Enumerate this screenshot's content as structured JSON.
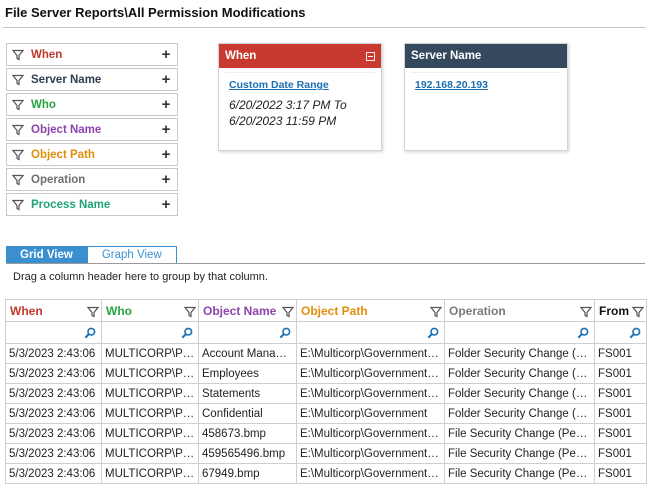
{
  "page_title": "File Server Reports\\All Permission Modifications",
  "filters": [
    {
      "label": "When",
      "color": "#c0392b"
    },
    {
      "label": "Server Name",
      "color": "#2f3e50"
    },
    {
      "label": "Who",
      "color": "#27a243"
    },
    {
      "label": "Object Name",
      "color": "#8e44ad"
    },
    {
      "label": "Object Path",
      "color": "#e08e0b"
    },
    {
      "label": "Operation",
      "color": "#6f6f6f"
    },
    {
      "label": "Process Name",
      "color": "#1fa37a"
    }
  ],
  "filter_add_symbol": "+",
  "when_card": {
    "title": "When",
    "header_color": "#c8392f",
    "link": "Custom Date Range",
    "range_line1": "6/20/2022 3:17 PM To",
    "range_line2": "6/20/2023 11:59 PM"
  },
  "server_card": {
    "title": "Server Name",
    "header_color": "#34495e",
    "link": "192.168.20.193"
  },
  "tabs": [
    {
      "label": "Grid View",
      "active": true
    },
    {
      "label": "Graph View",
      "active": false
    }
  ],
  "group_hint": "Drag a column header here to group by that column.",
  "columns": [
    {
      "label": "When",
      "color": "#c0392b"
    },
    {
      "label": "Who",
      "color": "#27a243"
    },
    {
      "label": "Object Name",
      "color": "#8e44ad"
    },
    {
      "label": "Object Path",
      "color": "#e08e0b"
    },
    {
      "label": "Operation",
      "color": "#7a7a7a"
    },
    {
      "label": "From",
      "color": "#111111"
    }
  ],
  "rows": [
    [
      "5/3/2023 2:43:06",
      "MULTICORP\\Paul",
      "Account Managers",
      "E:\\Multicorp\\Government\\A...",
      "Folder Security Change (Per...",
      "FS001"
    ],
    [
      "5/3/2023 2:43:06",
      "MULTICORP\\Paul",
      "Employees",
      "E:\\Multicorp\\Government\\A...",
      "Folder Security Change (Per...",
      "FS001"
    ],
    [
      "5/3/2023 2:43:06",
      "MULTICORP\\Paul",
      "Statements",
      "E:\\Multicorp\\Government\\A...",
      "Folder Security Change (Per...",
      "FS001"
    ],
    [
      "5/3/2023 2:43:06",
      "MULTICORP\\Paul",
      "Confidential",
      "E:\\Multicorp\\Government",
      "Folder Security Change (Per...",
      "FS001"
    ],
    [
      "5/3/2023 2:43:06",
      "MULTICORP\\Paul",
      "458673.bmp",
      "E:\\Multicorp\\Government\\C...",
      "File Security Change (Permis...",
      "FS001"
    ],
    [
      "5/3/2023 2:43:06",
      "MULTICORP\\Paul",
      "459565496.bmp",
      "E:\\Multicorp\\Government\\C...",
      "File Security Change (Permis...",
      "FS001"
    ],
    [
      "5/3/2023 2:43:06",
      "MULTICORP\\Paul",
      "67949.bmp",
      "E:\\Multicorp\\Government\\C...",
      "File Security Change (Permis...",
      "FS001"
    ]
  ]
}
